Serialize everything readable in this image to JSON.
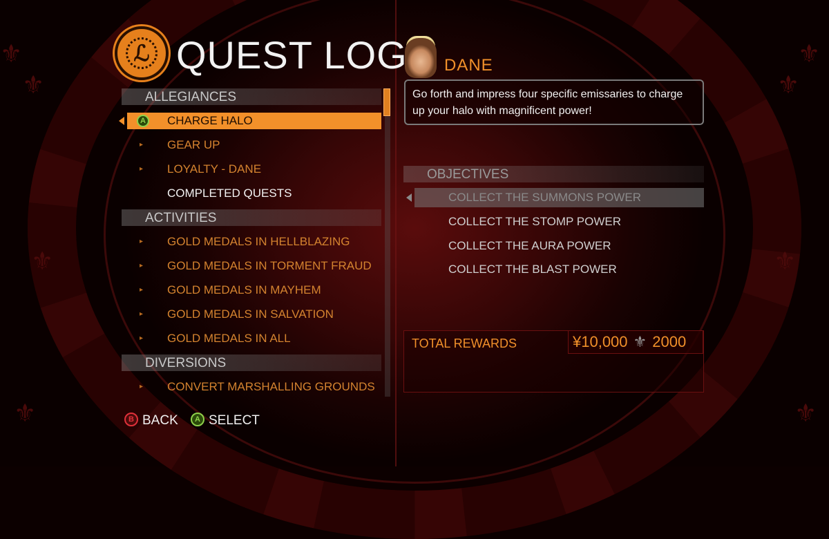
{
  "title": "QUEST LOG",
  "logo_glyph": "ℒ",
  "left_list": {
    "categories": [
      {
        "label": "ALLEGIANCES",
        "items": [
          {
            "label": "CHARGE HALO",
            "state": "selected"
          },
          {
            "label": "GEAR UP",
            "state": "normal"
          },
          {
            "label": "LOYALTY - DANE",
            "state": "normal"
          },
          {
            "label": "COMPLETED QUESTS",
            "state": "completed"
          }
        ]
      },
      {
        "label": "ACTIVITIES",
        "items": [
          {
            "label": "GOLD MEDALS IN HELLBLAZING",
            "state": "normal"
          },
          {
            "label": "GOLD MEDALS IN TORMENT FRAUD",
            "state": "normal"
          },
          {
            "label": "GOLD MEDALS IN MAYHEM",
            "state": "normal"
          },
          {
            "label": "GOLD MEDALS IN SALVATION",
            "state": "normal"
          },
          {
            "label": "GOLD MEDALS IN ALL",
            "state": "normal"
          }
        ]
      },
      {
        "label": "DIVERSIONS",
        "items": [
          {
            "label": "CONVERT MARSHALLING GROUNDS",
            "state": "normal"
          }
        ]
      }
    ]
  },
  "buttons": {
    "back_glyph": "B",
    "back_label": "BACK",
    "select_glyph": "A",
    "select_label": "SELECT"
  },
  "quest": {
    "speaker": "DANE",
    "description": "Go forth and impress four specific emissaries to charge up your halo with magnificent power!",
    "objectives_header": "OBJECTIVES",
    "objectives": [
      "COLLECT THE SUMMONS POWER",
      "COLLECT THE STOMP POWER",
      "COLLECT THE AURA POWER",
      "COLLECT THE BLAST POWER"
    ],
    "rewards_label": "TOTAL REWARDS",
    "money": "¥10,000",
    "respect": "2000",
    "respect_glyph": "⚜"
  },
  "colors": {
    "accent": "#f2902a",
    "button_a": "#8ed14a",
    "button_b": "#e0303a"
  }
}
